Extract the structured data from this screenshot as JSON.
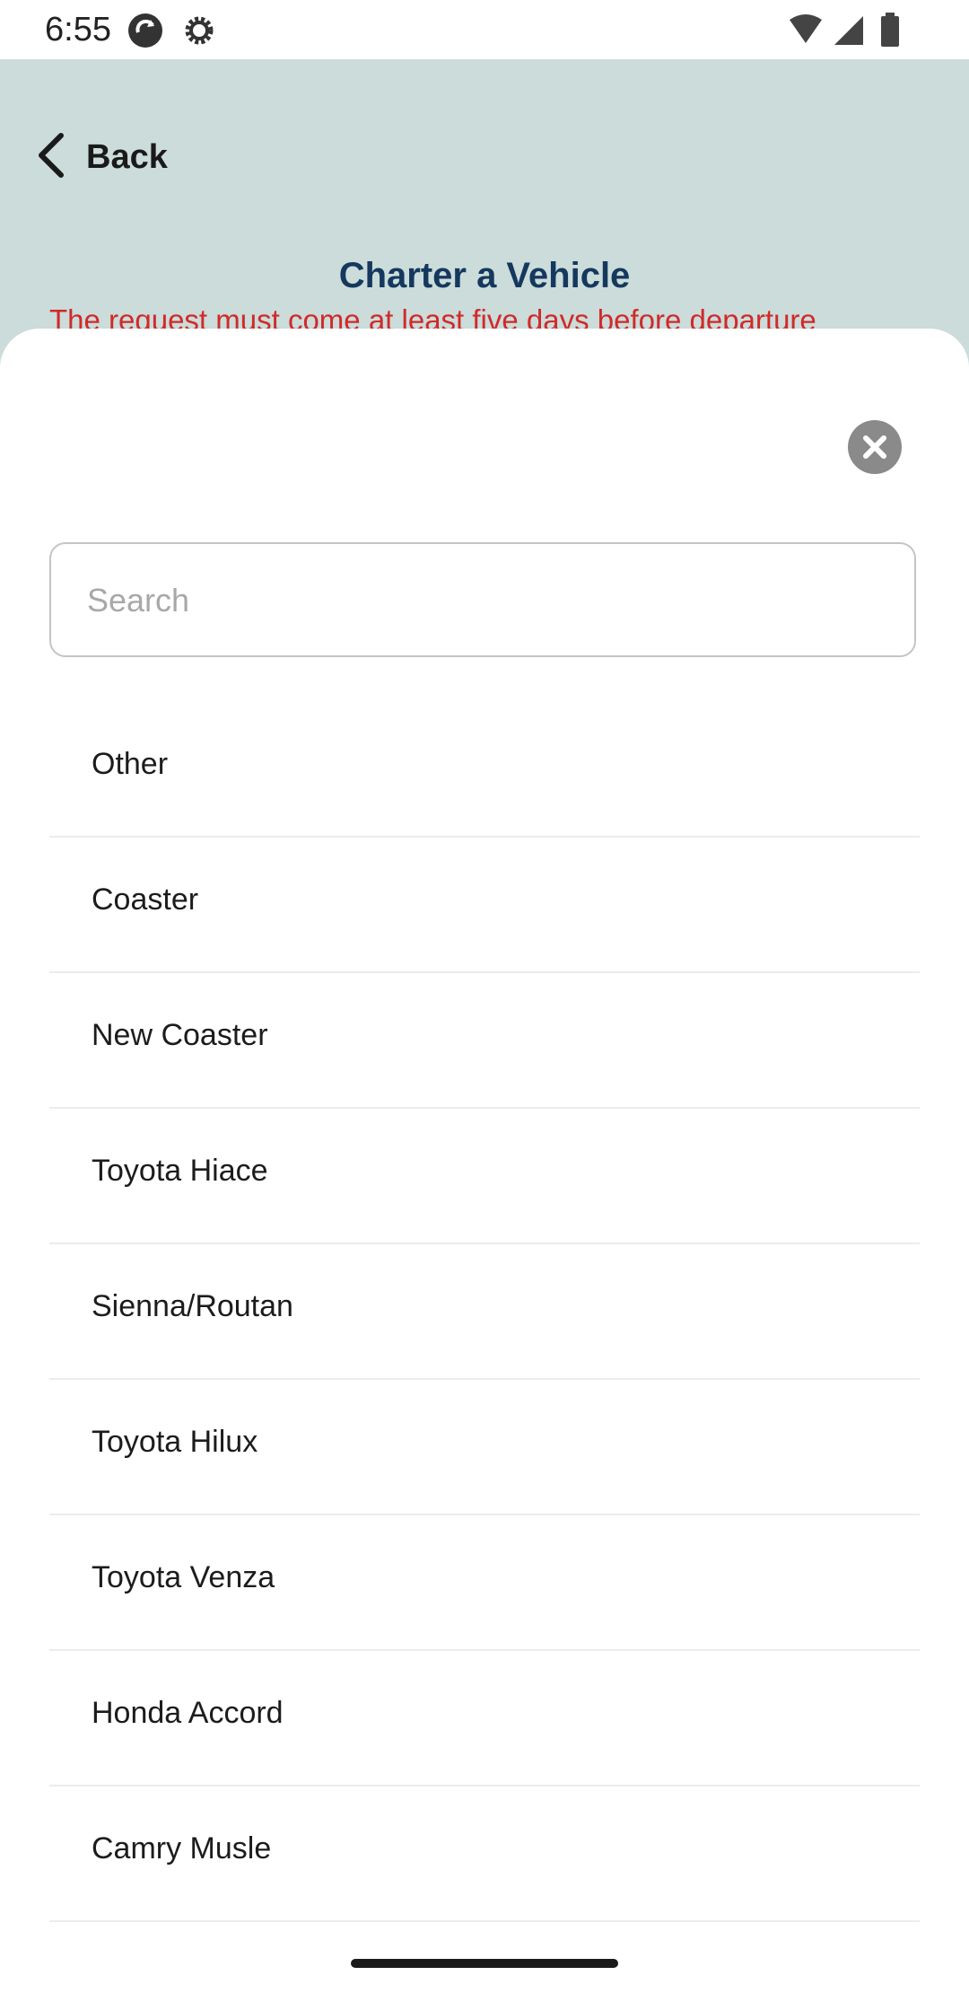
{
  "status_bar": {
    "time": "6:55",
    "icons": [
      "sync-app-icon",
      "settings-gear-icon",
      "wifi-icon",
      "cell-signal-icon",
      "battery-icon"
    ]
  },
  "header": {
    "back_label": "Back",
    "title": "Charter a Vehicle",
    "notice": "The request must come at least five days before departure"
  },
  "sheet": {
    "search": {
      "placeholder": "Search",
      "value": ""
    },
    "items": [
      {
        "label": "Other"
      },
      {
        "label": "Coaster"
      },
      {
        "label": "New Coaster"
      },
      {
        "label": "Toyota Hiace"
      },
      {
        "label": "Sienna/Routan"
      },
      {
        "label": "Toyota Hilux"
      },
      {
        "label": "Toyota Venza"
      },
      {
        "label": "Honda Accord"
      },
      {
        "label": "Camry Musle"
      }
    ]
  },
  "colors": {
    "header_bg": "#cbdcda",
    "title": "#15385e",
    "notice": "#d02a2a",
    "close_button": "#8a8a8a"
  }
}
